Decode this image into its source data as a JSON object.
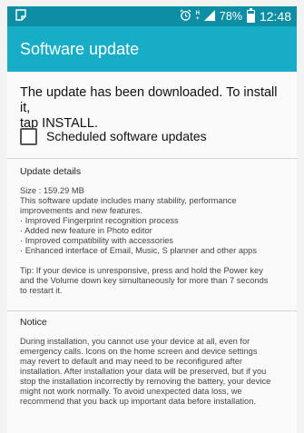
{
  "status_bar": {
    "left_icon": "screenshot-icon",
    "icons": [
      "alarm-icon",
      "network-h-plus-icon",
      "signal-icon",
      "battery-icon"
    ],
    "network_label": "H",
    "network_sub": "+",
    "battery_percent": "78%",
    "battery_level": 0.78,
    "time": "12:48"
  },
  "header": {
    "title": "Software update"
  },
  "main": {
    "message_line1": "The update has been downloaded. To install it,",
    "message_line2": "tap INSTALL.",
    "scheduled_label": "Scheduled software updates",
    "scheduled_checked": false,
    "details": {
      "heading": "Update details",
      "size": "Size : 159.29 MB",
      "intro_line1": "This software update includes many stability, performance",
      "intro_line2": "improvements and new features.",
      "bullets": [
        "Improved Fingerprint recognition process",
        "Added new feature in Photo editor",
        "Improved compatibility with accessories",
        "Enhanced interface of Email, Music, S planner and other apps"
      ],
      "tip_line1": "Tip: If your device is unresponsive, press and hold the Power key",
      "tip_line2": "and the Volume down key simultaneously for more than 7 seconds",
      "tip_line3": "to restart it."
    },
    "notice": {
      "heading": "Notice",
      "lines": [
        "During installation, you cannot use your device at all, even for",
        "emergency calls. Icons on the home screen and device settings",
        "may revert to default and may need to be reconfigured after",
        "installation. After installation your data will be preserved, but if you",
        "stop the installation incorrectly by removing the battery, your device",
        "might not work normally. To avoid unexpected data loss, we",
        "recommend that you back up important data before installation."
      ]
    }
  },
  "colors": {
    "status_bar": "#0e8ea4",
    "title_bar": "#18adc6",
    "background": "#fafafa"
  }
}
